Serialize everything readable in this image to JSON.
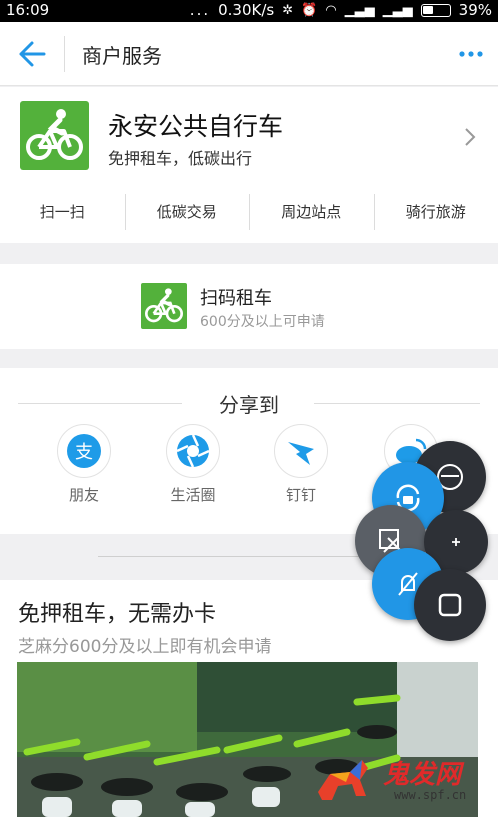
{
  "status_bar": {
    "time": "16:09",
    "dots": "...",
    "network_speed": "0.30K/s",
    "battery": "39%"
  },
  "nav": {
    "title": "商户服务",
    "back_icon": "arrow-left-icon",
    "more_icon": "more-dots-icon"
  },
  "merchant": {
    "name": "永安公共自行车",
    "subtitle": "免押租车，低碳出行",
    "tabs": [
      {
        "label": "扫一扫"
      },
      {
        "label": "低碳交易"
      },
      {
        "label": "周边站点"
      },
      {
        "label": "骑行旅游"
      }
    ]
  },
  "scan_card": {
    "title": "扫码租车",
    "subtitle": "600分及以上可申请"
  },
  "share": {
    "title": "分享到",
    "items": [
      {
        "label": "朋友",
        "icon": "alipay-friend-icon"
      },
      {
        "label": "生活圈",
        "icon": "life-circle-icon"
      },
      {
        "label": "钉钉",
        "icon": "dingtalk-icon"
      },
      {
        "label": "",
        "icon": "weibo-icon"
      }
    ]
  },
  "promo": {
    "title": "免押租车，无需办卡",
    "subtitle": "芝麻分600分及以上即有机会申请"
  },
  "floating_buttons": [
    "orientation-lock-icon",
    "rotate-lock-icon",
    "screenshot-cut-icon",
    "plus-icon",
    "bell-off-icon",
    "square-icon"
  ],
  "watermark": {
    "text": "鬼发网",
    "url": "www.spf.cn"
  },
  "colors": {
    "accent_blue": "#2196e6",
    "brand_green": "#53b13b",
    "overlay_dark": "#2d3036"
  }
}
